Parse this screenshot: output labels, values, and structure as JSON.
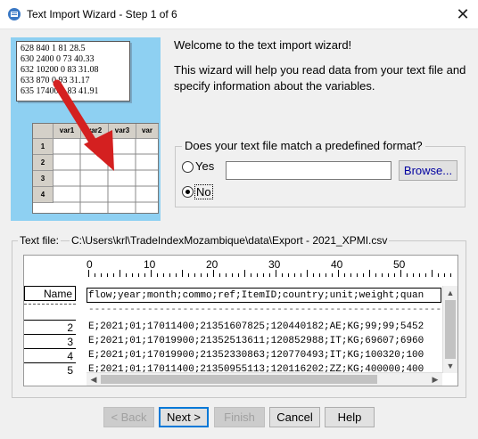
{
  "window": {
    "title": "Text Import Wizard - Step 1 of 6",
    "close_glyph": "✕"
  },
  "illustration": {
    "note_lines": [
      "628 840 1 81 28.5",
      "630 2400 0 73 40.33",
      "632 10200 0 83 31.08",
      "633 870 0 93 31.17",
      "635 17400 0 83 41.91"
    ],
    "sheet_headers": [
      "var1",
      "var2",
      "var3",
      "var"
    ],
    "sheet_rows": [
      "1",
      "2",
      "3",
      "4"
    ],
    "arrow_color": "#d42020"
  },
  "welcome": {
    "heading": "Welcome to the text import wizard!",
    "description": "This wizard will help you read data from your text file and specify information about the variables."
  },
  "format": {
    "question": "Does your text file match a predefined format?",
    "yes_label": "Yes",
    "no_label": "No",
    "selected": "No",
    "path_value": "",
    "browse_label": "Browse..."
  },
  "file": {
    "label": "Text file:",
    "path": "C:\\Users\\krl\\TradeIndexMozambique\\data\\Export - 2021_XPMI.csv"
  },
  "preview": {
    "ruler_numbers": [
      "0",
      "10",
      "20",
      "30",
      "40",
      "50"
    ],
    "name_header": "Name",
    "line_numbers": [
      "2",
      "3",
      "4",
      "5"
    ],
    "header_line": "flow;year;month;commo;ref;ItemID;country;unit;weight;quan",
    "rule_line": "------------------------------------------------------------",
    "data_lines": [
      "E;2021;01;17011400;21351607825;120440182;AE;KG;99;99;5452",
      "E;2021;01;17019900;21352513611;120852988;IT;KG;69607;6960",
      "E;2021;01;17019900;21352330863;120770493;IT;KG;100320;100",
      "E;2021;01;17011400;21350955113;120116202;ZZ;KG;400000;400"
    ]
  },
  "buttons": {
    "back": "< Back",
    "next": "Next >",
    "finish": "Finish",
    "cancel": "Cancel",
    "help": "Help"
  },
  "colors": {
    "accent": "#0078d7",
    "illustration_bg": "#8ed0f2"
  }
}
